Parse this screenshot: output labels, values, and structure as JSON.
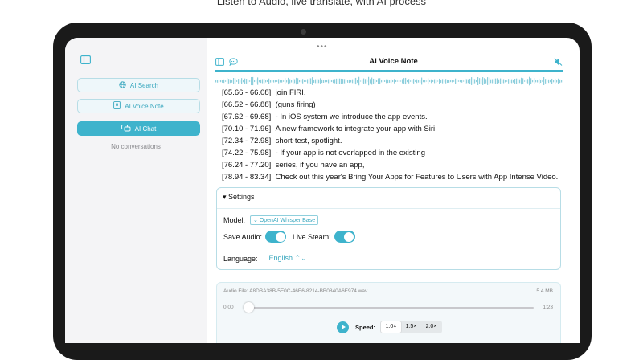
{
  "marketing": {
    "tagline": "Listen to Audio, live translate, with AI process"
  },
  "sidebar": {
    "toggle_icon": "sidebar-icon",
    "items": [
      {
        "label": "AI Search",
        "icon": "globe-icon",
        "active": false
      },
      {
        "label": "AI Voice Note",
        "icon": "voice-note-icon",
        "active": false
      },
      {
        "label": "AI Chat",
        "icon": "chat-bubbles-icon",
        "active": true
      }
    ],
    "empty_text": "No conversations"
  },
  "header": {
    "title": "AI Voice Note",
    "left_icons": [
      "sidebar-icon",
      "chat-bubble-icon"
    ],
    "right_icon": "speaker-muted-icon"
  },
  "transcript": [
    {
      "time": "[65.66 - 66.08]",
      "text": "join FIRI."
    },
    {
      "time": "[66.52 - 66.88]",
      "text": "(guns firing)"
    },
    {
      "time": "[67.62 - 69.68]",
      "text": "- In iOS system we introduce the app events."
    },
    {
      "time": "[70.10 - 71.96]",
      "text": "A new framework to integrate your app with Siri,"
    },
    {
      "time": "[72.34 - 72.98]",
      "text": "short-test, spotlight."
    },
    {
      "time": "[74.22 - 75.98]",
      "text": "- If your app is not overlapped in the existing"
    },
    {
      "time": "[76.24 - 77.20]",
      "text": "series, if you have an app,"
    },
    {
      "time": "[78.94 - 83.34]",
      "text": "Check out this year's Bring Your Apps for Features to Users with App Intense Video."
    }
  ],
  "settings": {
    "heading": "▾ Settings",
    "model_label": "Model:",
    "model_value": "⌄ OpenAI Whisper Base",
    "save_audio_label": "Save Audio:",
    "save_audio_on": true,
    "live_steam_label": "Live Steam:",
    "live_steam_on": true,
    "language_label": "Language:",
    "language_value": "English ⌃⌄"
  },
  "player": {
    "file_label": "Audio File: A8DBA38B-5E0C-46E6-8214-BB0840A6E974.wav",
    "file_size": "5.4 MB",
    "time_start": "0:00",
    "time_end": "1:23",
    "progress": 0,
    "speed_label": "Speed:",
    "speeds": [
      "1.0×",
      "1.5×",
      "2.0×"
    ],
    "selected_speed": "1.0×"
  },
  "colors": {
    "accent": "#3eb3cc",
    "device_frame": "#1a1a1a",
    "sidebar_bg": "#f4f4f6"
  }
}
